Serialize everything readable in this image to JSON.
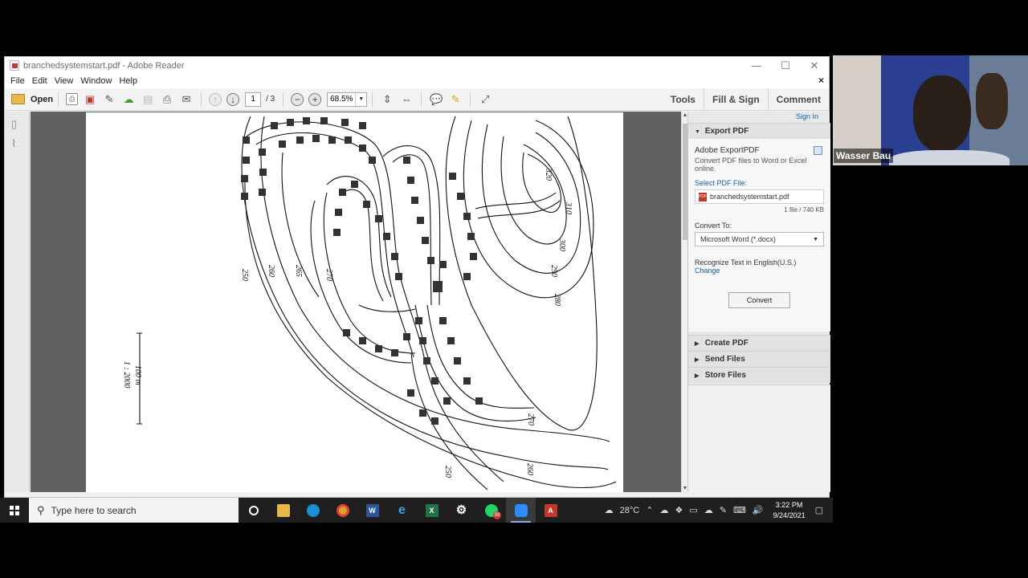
{
  "window": {
    "title": "branchedsystemstart.pdf - Adobe Reader",
    "controls": [
      "—",
      "☐",
      "✕"
    ]
  },
  "menu": {
    "items": [
      "File",
      "Edit",
      "View",
      "Window",
      "Help"
    ],
    "close_doc": "×"
  },
  "toolbar": {
    "open_label": "Open",
    "page_current": "1",
    "page_total": "/ 3",
    "zoom": "68.5%",
    "tools_label": "Tools",
    "fill_sign_label": "Fill & Sign",
    "comment_label": "Comment"
  },
  "map": {
    "contour_labels": [
      "250",
      "260",
      "265",
      "270",
      "300",
      "310",
      "320",
      "290",
      "280",
      "270",
      "260",
      "250"
    ],
    "scale_label": "100 m",
    "scale_ratio": "1 : 2000"
  },
  "right_panel": {
    "sign_in": "Sign In",
    "export_pdf": "Export PDF",
    "export_heading": "Adobe ExportPDF",
    "export_desc": "Convert PDF files to Word or Excel online.",
    "select_label": "Select PDF File:",
    "file_name": "branchedsystemstart.pdf",
    "file_count": "1 file / 740 KB",
    "convert_to_label": "Convert To:",
    "convert_to_value": "Microsoft Word (*.docx)",
    "recognize_text": "Recognize Text in English(U.S.)",
    "change_link": "Change",
    "convert_button": "Convert",
    "create_pdf": "Create PDF",
    "send_files": "Send Files",
    "store_files": "Store Files"
  },
  "webcam": {
    "name": "Wasser Bau"
  },
  "taskbar": {
    "search_placeholder": "Type here to search",
    "weather": "28°C",
    "time": "3:22 PM",
    "date": "9/24/2021",
    "whatsapp_badge": "99"
  },
  "colors": {
    "accent_link": "#1a5ea8",
    "adobe_red": "#c0392b",
    "taskbar": "#1f1f1f"
  }
}
